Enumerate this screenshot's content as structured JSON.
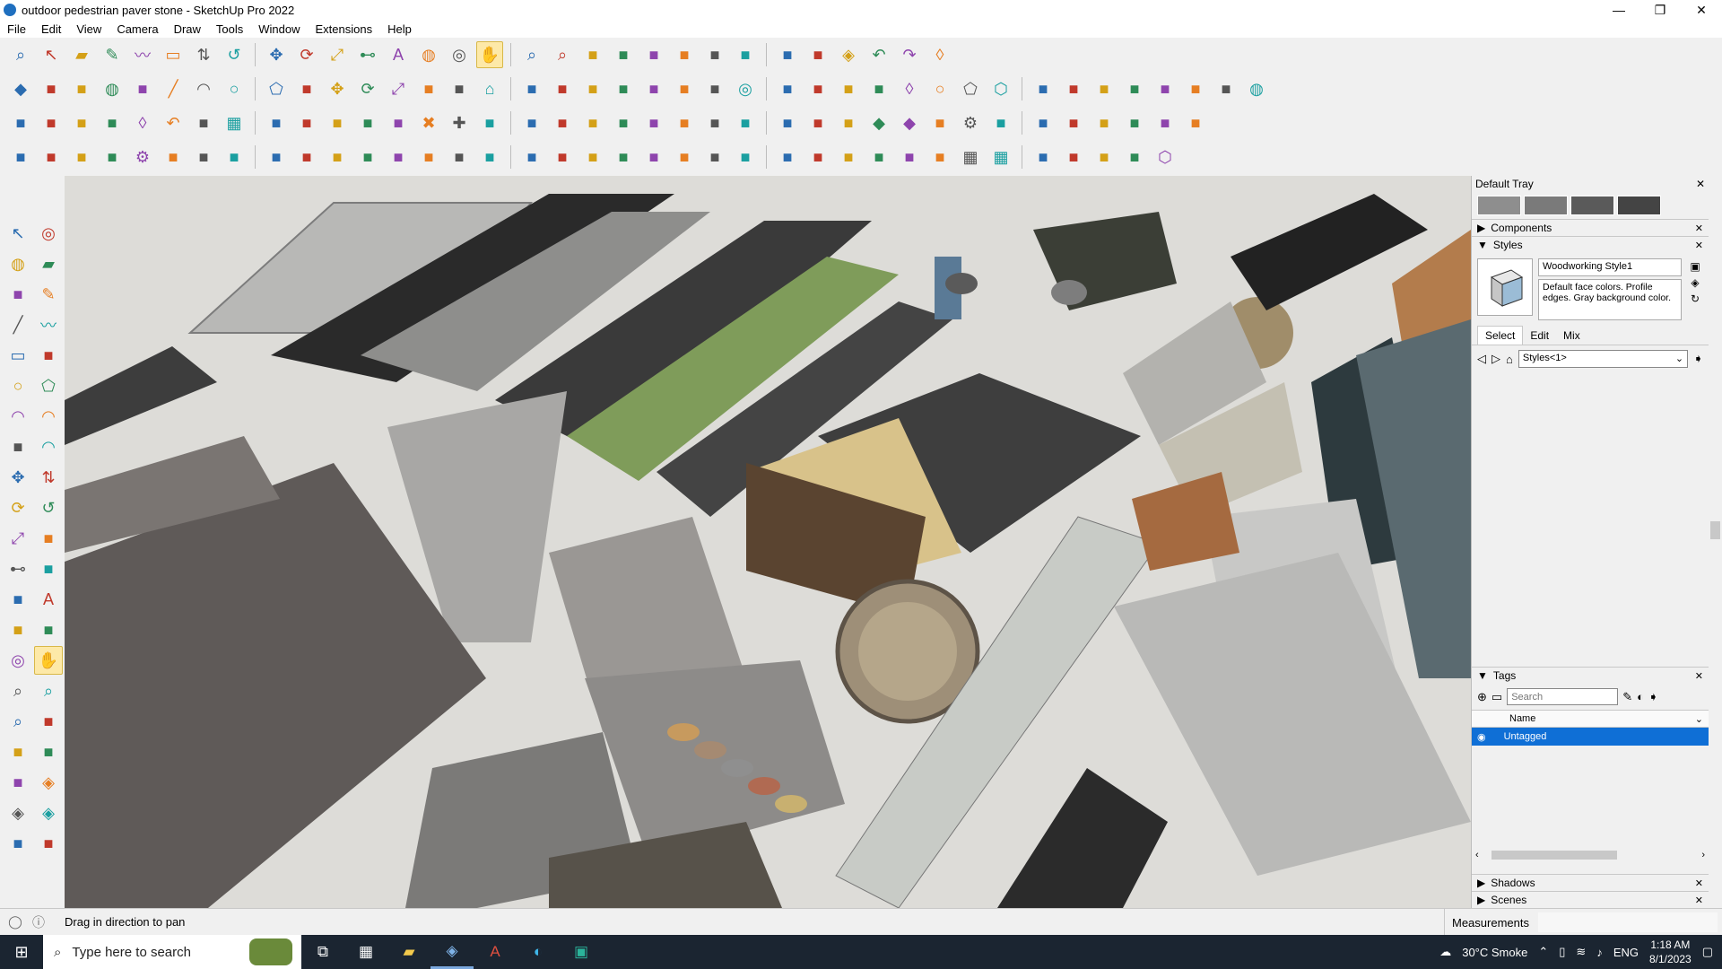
{
  "window": {
    "title": "outdoor pedestrian paver stone - SketchUp Pro 2022",
    "controls": {
      "minimize": "—",
      "restore": "❐",
      "close": "✕"
    }
  },
  "menu": [
    "File",
    "Edit",
    "View",
    "Camera",
    "Draw",
    "Tools",
    "Window",
    "Extensions",
    "Help"
  ],
  "toolbars": {
    "row1": [
      "zoom-icon",
      "select-icon",
      "eraser-icon",
      "pencil-icon",
      "freehand-icon",
      "rectangle-icon",
      "pushpull-icon",
      "followme-icon",
      "move-icon",
      "rotate-icon",
      "scale-icon",
      "tape-icon",
      "text-icon",
      "paint-icon",
      "orbit-icon",
      "pan-icon",
      "zoom-window-icon",
      "zoom-extents-icon",
      "iso-view-icon",
      "top-view-icon",
      "front-view-icon",
      "right-view-icon",
      "warehouse-icon",
      "extension-icon",
      "sandbox-icon",
      "axes-icon",
      "section-icon",
      "undo-icon",
      "redo-icon",
      "tag-icon"
    ],
    "row2": [
      "cube-icon",
      "component-icon",
      "group-icon",
      "paint-icon",
      "layer-icon",
      "line-icon",
      "arc-icon",
      "circle-icon",
      "polygon-icon",
      "offset-icon",
      "move-icon",
      "rotate-icon",
      "scale-icon",
      "flip-icon",
      "array-icon",
      "house-icon",
      "roof-icon",
      "door-icon",
      "window-icon",
      "wall-icon",
      "stair-icon",
      "texture-icon",
      "material-icon",
      "orbit-icon",
      "solid-icon",
      "intersect-icon",
      "trim-icon",
      "split-icon",
      "tag-icon",
      "circle-icon",
      "polygon-icon",
      "hexagon-icon",
      "curve-icon",
      "bezier-icon",
      "spline-icon",
      "blob-icon",
      "weld-icon",
      "explode-icon",
      "label-icon",
      "paint-icon"
    ],
    "row3": [
      "plane-icon",
      "plane2-icon",
      "plane3-icon",
      "plane4-icon",
      "tag-icon",
      "undo-curve-icon",
      "square-icon",
      "grid-icon",
      "frame-icon",
      "wood-icon",
      "pipe-icon",
      "bend-icon",
      "path-icon",
      "cross-icon",
      "plus-icon",
      "xform-icon",
      "cone-icon",
      "cone2-icon",
      "warn-icon",
      "loop-icon",
      "chain-icon",
      "spiral-icon",
      "pivot-icon",
      "lamp-icon",
      "hook-icon",
      "vine-icon",
      "stack-icon",
      "cube-icon",
      "cube2-icon",
      "box-icon",
      "gear-icon",
      "sofa-icon",
      "window-icon",
      "hatch-icon",
      "hatch2-icon",
      "scatter-icon",
      "node-icon",
      "qr-icon"
    ],
    "row4": [
      "polyline-icon",
      "spline-icon",
      "car-icon",
      "cut-icon",
      "gear-icon",
      "wrap-icon",
      "twist-icon",
      "sphere-icon",
      "shell-icon",
      "fork-icon",
      "fence-icon",
      "fence2-icon",
      "rail-icon",
      "ramp-icon",
      "cylinder-icon",
      "spike-icon",
      "column-icon",
      "column2-icon",
      "ring-icon",
      "leaf-icon",
      "arrow-icon",
      "stack-icon",
      "plank-icon",
      "saw-icon",
      "saw2-icon",
      "saw3-icon",
      "tread-icon",
      "tread2-icon",
      "truss-icon",
      "truss2-icon",
      "grid-icon",
      "grid2-icon",
      "fan-icon",
      "fan2-icon",
      "fan3-icon",
      "fan4-icon",
      "hexagon-icon"
    ]
  },
  "left_tools": [
    "select-icon",
    "orbit-icon",
    "paint-icon",
    "eraser-icon",
    "component-icon",
    "pencil-icon",
    "line-icon",
    "freehand-icon",
    "rectangle-icon",
    "rotated-rect-icon",
    "circle-icon",
    "polygon-icon",
    "arc-icon",
    "arc3-icon",
    "pie-icon",
    "arc2-icon",
    "move-icon",
    "pushpull-icon",
    "rotate-icon",
    "followme-icon",
    "scale-icon",
    "offset-icon",
    "tape-icon",
    "dimension-icon",
    "protractor-icon",
    "text-icon",
    "axes-icon",
    "3dtext-icon",
    "orbit-icon",
    "pan-icon",
    "zoom-icon",
    "zoom-window-icon",
    "zoom-extents-icon",
    "previous-icon",
    "position-camera-icon",
    "look-around-icon",
    "walk-icon",
    "section-icon",
    "section-display-icon",
    "section-cut-icon",
    "display-section-icon",
    "hide-section-icon"
  ],
  "tray": {
    "title": "Default Tray",
    "components_label": "Components",
    "styles_label": "Styles",
    "style_name": "Woodworking Style1",
    "style_desc": "Default face colors. Profile edges. Gray background color.",
    "tabs": [
      "Select",
      "Edit",
      "Mix"
    ],
    "active_tab": "Select",
    "style_dropdown": "Styles<1>",
    "tags_label": "Tags",
    "search_placeholder": "Search",
    "name_col": "Name",
    "tag_row": "Untagged",
    "shadows_label": "Shadows",
    "scenes_label": "Scenes"
  },
  "status": {
    "message": "Drag in direction to pan",
    "measurements_label": "Measurements"
  },
  "taskbar": {
    "search_placeholder": "Type here to search",
    "weather": "30°C  Smoke",
    "lang": "ENG",
    "time": "1:18 AM",
    "date": "8/1/2023"
  },
  "colors": {
    "accent": "#0f6fd6",
    "taskbar": "#1b2531",
    "viewport_bg": "#d9d8d4"
  }
}
